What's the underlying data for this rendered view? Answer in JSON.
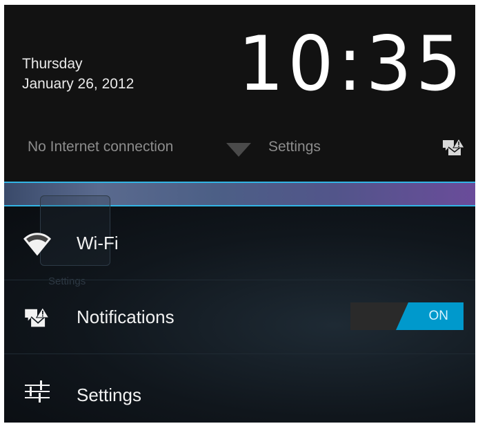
{
  "header": {
    "day": "Thursday",
    "date": "January 26, 2012",
    "time_hours": "10",
    "time_minutes": "35",
    "time_separator": ":"
  },
  "status": {
    "connection_text": "No Internet connection",
    "settings_label": "Settings",
    "wifi_icon": "wifi-signal-icon",
    "notification_icon": "notifications-icon"
  },
  "quick_settings": {
    "items": [
      {
        "label": "Wi-Fi",
        "icon": "wifi-icon"
      },
      {
        "label": "Notifications",
        "icon": "notifications-icon",
        "toggle": "ON"
      },
      {
        "label": "Settings",
        "icon": "sliders-icon"
      }
    ],
    "ghost_label": "Settings"
  },
  "colors": {
    "accent": "#33b5e5",
    "toggle_on": "#0099cc",
    "background": "#000000"
  }
}
